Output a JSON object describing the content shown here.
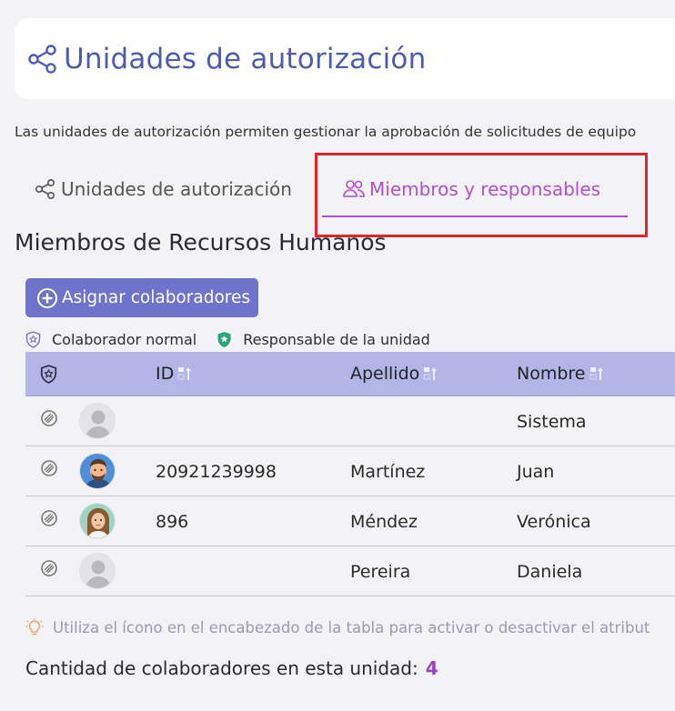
{
  "header": {
    "title": "Unidades de autorización"
  },
  "description": "Las unidades de autorización permiten gestionar la aprobación de solicitudes de equipo",
  "tabs": [
    {
      "label": "Unidades de autorización",
      "active": false
    },
    {
      "label": "Miembros y responsables",
      "active": true
    }
  ],
  "section": {
    "title": "Miembros de Recursos Humanos"
  },
  "assign_button": {
    "label": "Asignar colaboradores"
  },
  "legend": {
    "normal": "Colaborador normal",
    "responsible": "Responsable de la unidad"
  },
  "table": {
    "columns": {
      "id": "ID",
      "last": "Apellido",
      "first": "Nombre"
    },
    "rows": [
      {
        "id": "",
        "last": "",
        "first": "Sistema",
        "avatar": "default"
      },
      {
        "id": "20921239998",
        "last": "Martínez",
        "first": "Juan",
        "avatar": "man"
      },
      {
        "id": "896",
        "last": "Méndez",
        "first": "Verónica",
        "avatar": "woman"
      },
      {
        "id": "",
        "last": "Pereira",
        "first": "Daniela",
        "avatar": "default"
      }
    ]
  },
  "tip": "Utiliza el ícono en el encabezado de la tabla para activar o desactivar el atribut",
  "count": {
    "label": "Cantidad de colaboradores en esta unidad:",
    "value": "4"
  },
  "colors": {
    "accent": "#b24fd0",
    "button": "#6f73c9",
    "table_header": "#b2b5e6",
    "title": "#4f5bb0",
    "highlight": "#e0262b"
  }
}
